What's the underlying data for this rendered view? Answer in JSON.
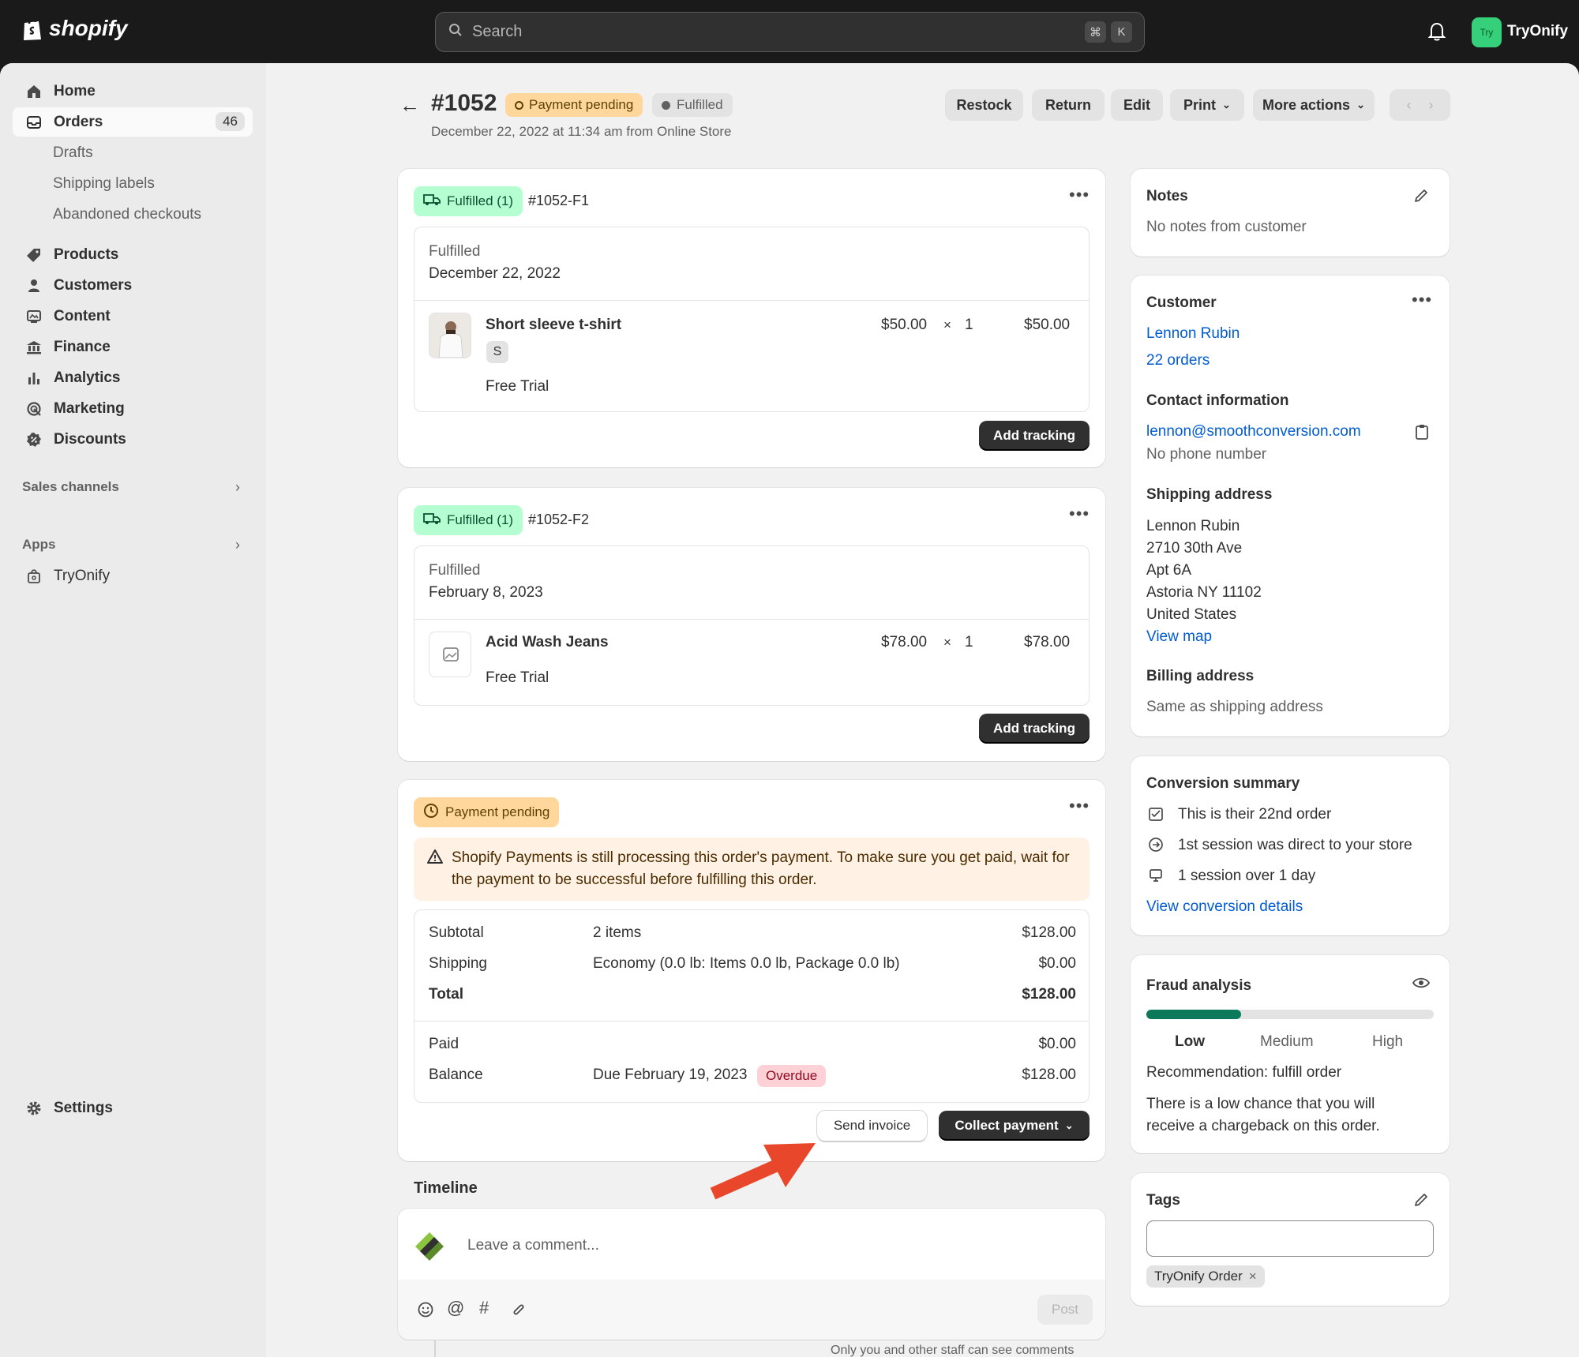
{
  "topbar": {
    "brand": "shopify",
    "search_placeholder": "Search",
    "shortcut_key1": "⌘",
    "shortcut_key2": "K",
    "store_avatar": "Try",
    "store_name": "TryOnify"
  },
  "sidebar": {
    "items": [
      {
        "label": "Home",
        "icon": "home-icon"
      },
      {
        "label": "Orders",
        "icon": "orders-icon",
        "badge": "46"
      },
      {
        "label": "Drafts"
      },
      {
        "label": "Shipping labels"
      },
      {
        "label": "Abandoned checkouts"
      },
      {
        "label": "Products",
        "icon": "tag-icon"
      },
      {
        "label": "Customers",
        "icon": "person-icon"
      },
      {
        "label": "Content",
        "icon": "image-icon"
      },
      {
        "label": "Finance",
        "icon": "bank-icon"
      },
      {
        "label": "Analytics",
        "icon": "bar-chart-icon"
      },
      {
        "label": "Marketing",
        "icon": "target-icon"
      },
      {
        "label": "Discounts",
        "icon": "discount-icon"
      }
    ],
    "sales_channels": "Sales channels",
    "apps": "Apps",
    "app_item": "TryOnify",
    "settings": "Settings"
  },
  "header": {
    "order_number": "#1052",
    "payment_status": "Payment pending",
    "fulfillment_status": "Fulfilled",
    "subtitle": "December 22, 2022 at 11:34 am from Online Store",
    "actions": [
      "Restock",
      "Return",
      "Edit",
      "Print",
      "More actions"
    ]
  },
  "fulfillments": [
    {
      "badge": "Fulfilled (1)",
      "id": "#1052-F1",
      "status": "Fulfilled",
      "date": "December 22, 2022",
      "item_name": "Short sleeve t-shirt",
      "variant": "S",
      "plan": "Free Trial",
      "price": "$50.00",
      "times": "×",
      "qty": "1",
      "total": "$50.00",
      "button": "Add tracking"
    },
    {
      "badge": "Fulfilled (1)",
      "id": "#1052-F2",
      "status": "Fulfilled",
      "date": "February 8, 2023",
      "item_name": "Acid Wash Jeans",
      "plan": "Free Trial",
      "price": "$78.00",
      "times": "×",
      "qty": "1",
      "total": "$78.00",
      "button": "Add tracking"
    }
  ],
  "payment": {
    "badge": "Payment pending",
    "warning": "Shopify Payments is still processing this order's payment. To make sure you get paid, wait for the payment to be successful before fulfilling this order.",
    "subtotal_label": "Subtotal",
    "subtotal_desc": "2 items",
    "subtotal_value": "$128.00",
    "shipping_label": "Shipping",
    "shipping_desc": "Economy (0.0 lb: Items 0.0 lb, Package 0.0 lb)",
    "shipping_value": "$0.00",
    "total_label": "Total",
    "total_value": "$128.00",
    "paid_label": "Paid",
    "paid_value": "$0.00",
    "balance_label": "Balance",
    "balance_desc": "Due February 19, 2023",
    "balance_badge": "Overdue",
    "balance_value": "$128.00",
    "send_invoice": "Send invoice",
    "collect_payment": "Collect payment"
  },
  "timeline": {
    "title": "Timeline",
    "comment_placeholder": "Leave a comment...",
    "post": "Post",
    "note": "Only you and other staff can see comments"
  },
  "notes": {
    "title": "Notes",
    "text": "No notes from customer"
  },
  "customer": {
    "title": "Customer",
    "name": "Lennon Rubin",
    "orders": "22 orders",
    "contact_title": "Contact information",
    "email": "lennon@smoothconversion.com",
    "phone": "No phone number",
    "shipping_title": "Shipping address",
    "address": [
      "Lennon Rubin",
      "2710 30th Ave",
      "Apt 6A",
      "Astoria NY 11102",
      "United States"
    ],
    "view_map": "View map",
    "billing_title": "Billing address",
    "billing": "Same as shipping address"
  },
  "conversion": {
    "title": "Conversion summary",
    "rows": [
      "This is their 22nd order",
      "1st session was direct to your store",
      "1 session over 1 day"
    ],
    "link": "View conversion details"
  },
  "fraud": {
    "title": "Fraud analysis",
    "level": 0.33,
    "levels": [
      "Low",
      "Medium",
      "High"
    ],
    "recommendation": "Recommendation: fulfill order",
    "description_line1": "There is a low chance that you will",
    "description_line2": "receive a chargeback on this order."
  },
  "tags": {
    "title": "Tags",
    "items": [
      "TryOnify Order"
    ]
  },
  "colors": {
    "accent_link": "#005bd3",
    "fulfilled_badge": "#b4fed2",
    "pending_badge": "#ffd79d",
    "fraud_low": "#0c7a5a",
    "annotation_arrow": "#e8472b"
  }
}
